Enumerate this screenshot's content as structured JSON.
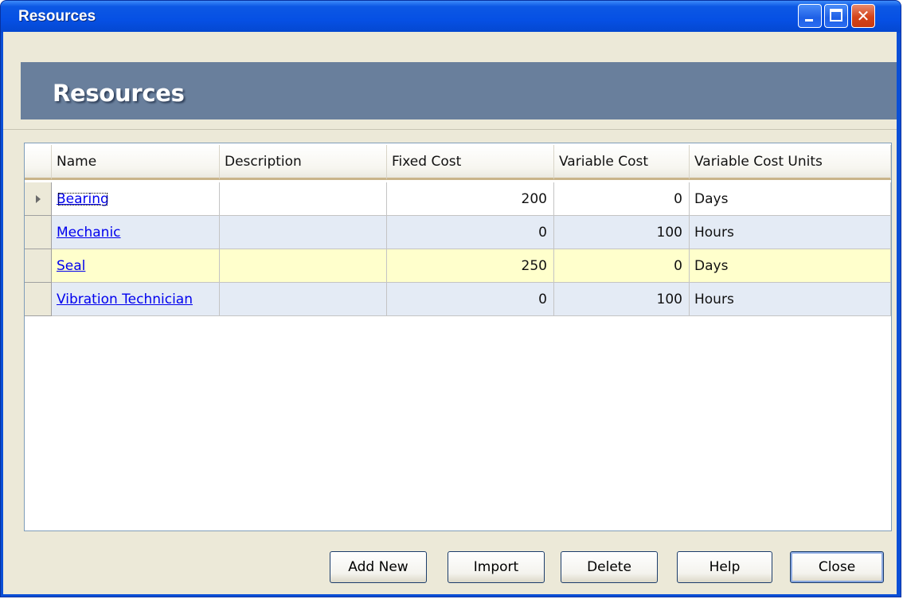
{
  "window": {
    "title": "Resources"
  },
  "banner": {
    "title": "Resources"
  },
  "grid": {
    "columns": [
      "Name",
      "Description",
      "Fixed Cost",
      "Variable Cost",
      "Variable Cost Units"
    ],
    "rows": [
      {
        "name": "Bearing",
        "description": "",
        "fixed_cost": "200",
        "variable_cost": "0",
        "units": "Days"
      },
      {
        "name": "Mechanic",
        "description": "",
        "fixed_cost": "0",
        "variable_cost": "100",
        "units": "Hours"
      },
      {
        "name": "Seal",
        "description": "",
        "fixed_cost": "250",
        "variable_cost": "0",
        "units": "Days"
      },
      {
        "name": "Vibration Technician",
        "description": "",
        "fixed_cost": "0",
        "variable_cost": "100",
        "units": "Hours"
      }
    ]
  },
  "buttons": {
    "add_new": "Add New",
    "import": "Import",
    "delete": "Delete",
    "help": "Help",
    "close": "Close"
  },
  "colors": {
    "title_bar": "#0650e4",
    "banner": "#697f9c",
    "row_alt": "#e4ebf5",
    "row_highlight": "#ffffcc",
    "link": "#0000ee"
  },
  "icons": [
    "minimize-icon",
    "maximize-icon",
    "close-icon",
    "row-selector-arrow-icon"
  ]
}
